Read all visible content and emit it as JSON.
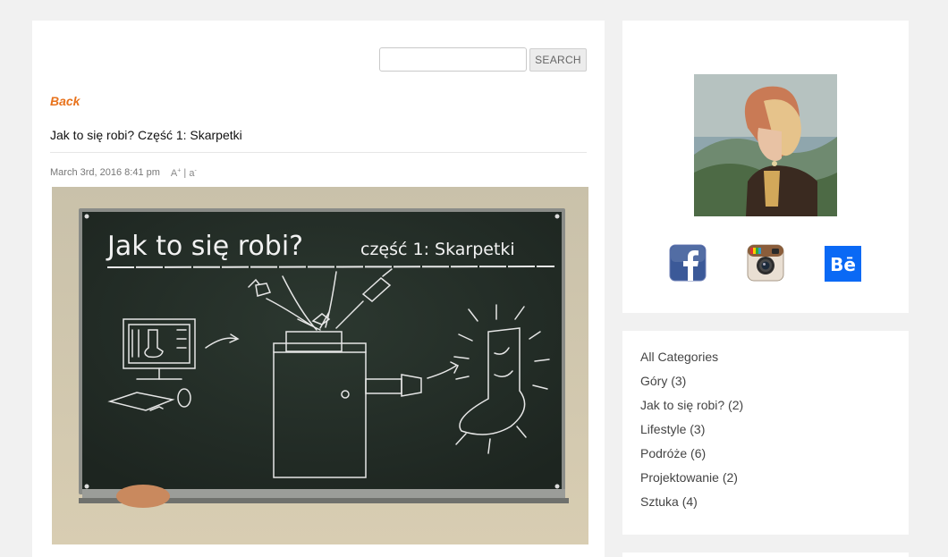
{
  "search": {
    "placeholder": "",
    "button_label": "SEARCH"
  },
  "post": {
    "back_label": "Back",
    "title": "Jak to się robi? Część 1: Skarpetki",
    "date": "March 3rd, 2016 8:41 pm",
    "font_controls": {
      "increase": "A",
      "sep": "|",
      "decrease": "a"
    },
    "image_text": {
      "title": "Jak to się robi?",
      "subtitle": "część 1: Skarpetki"
    }
  },
  "sidebar": {
    "social": [
      {
        "name": "facebook"
      },
      {
        "name": "instagram"
      },
      {
        "name": "behance",
        "label": "Bē"
      }
    ],
    "categories": [
      {
        "label": "All Categories"
      },
      {
        "label": "Góry (3)"
      },
      {
        "label": "Jak to się robi? (2)"
      },
      {
        "label": "Lifestyle (3)"
      },
      {
        "label": "Podróże (6)"
      },
      {
        "label": "Projektowanie (2)"
      },
      {
        "label": "Sztuka (4)"
      }
    ]
  },
  "colors": {
    "accent": "#e8731d",
    "facebook": "#3b5998",
    "behance": "#0a69f5",
    "chalkboard": "#253028"
  }
}
